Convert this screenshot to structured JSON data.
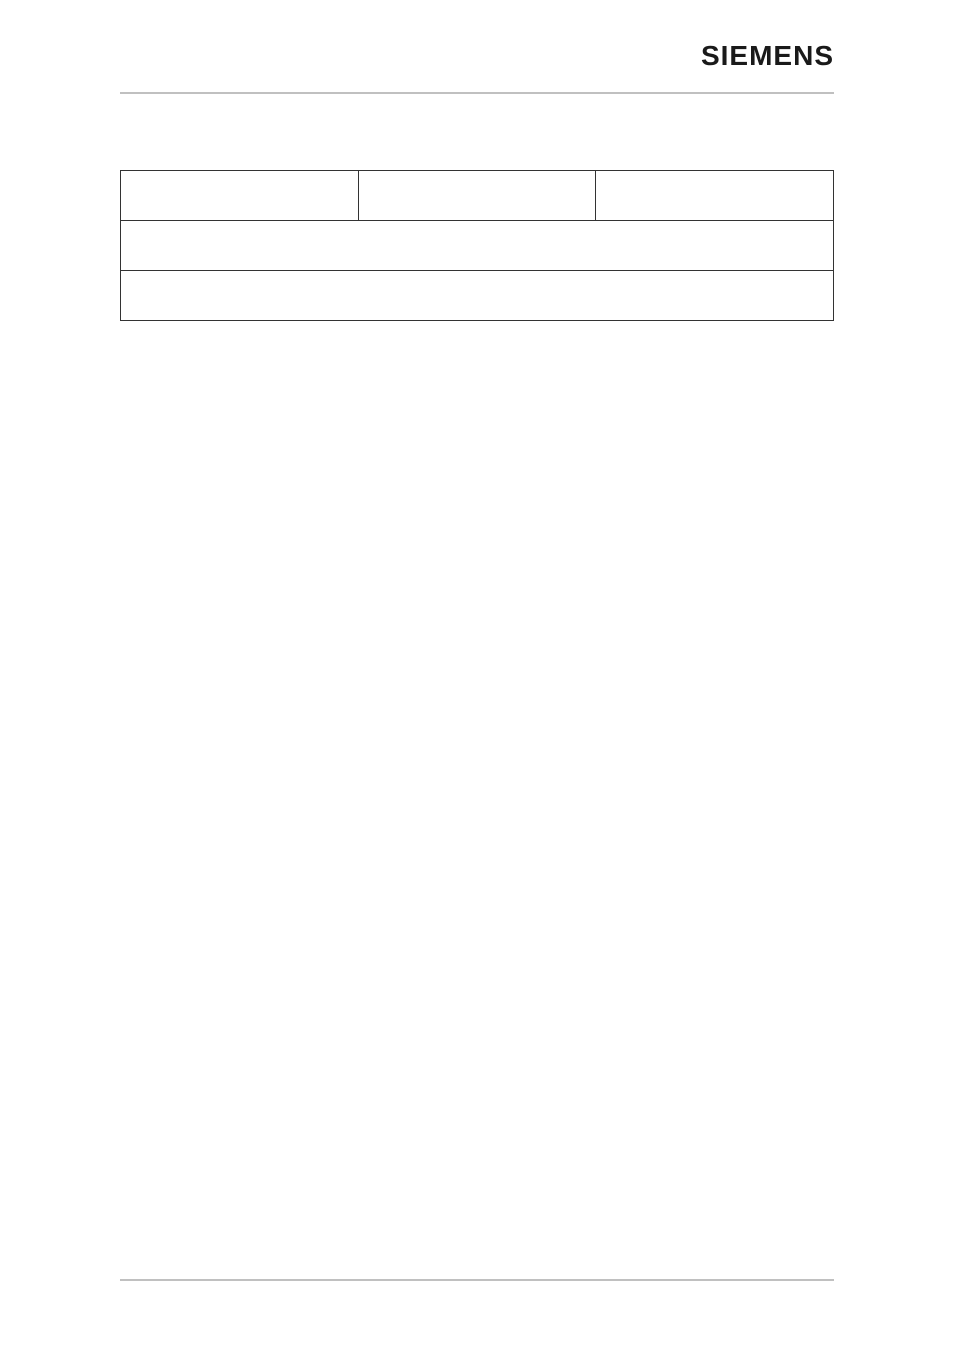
{
  "header": {
    "logo": "SIEMENS"
  },
  "table": {
    "rows": [
      {
        "cells": [
          "",
          "",
          ""
        ]
      },
      {
        "cells": [
          ""
        ]
      },
      {
        "cells": [
          ""
        ]
      }
    ]
  },
  "note": {
    "heading": "",
    "link_text": "",
    "link_href": "#"
  },
  "footer": {
    "left": "",
    "right": ""
  }
}
